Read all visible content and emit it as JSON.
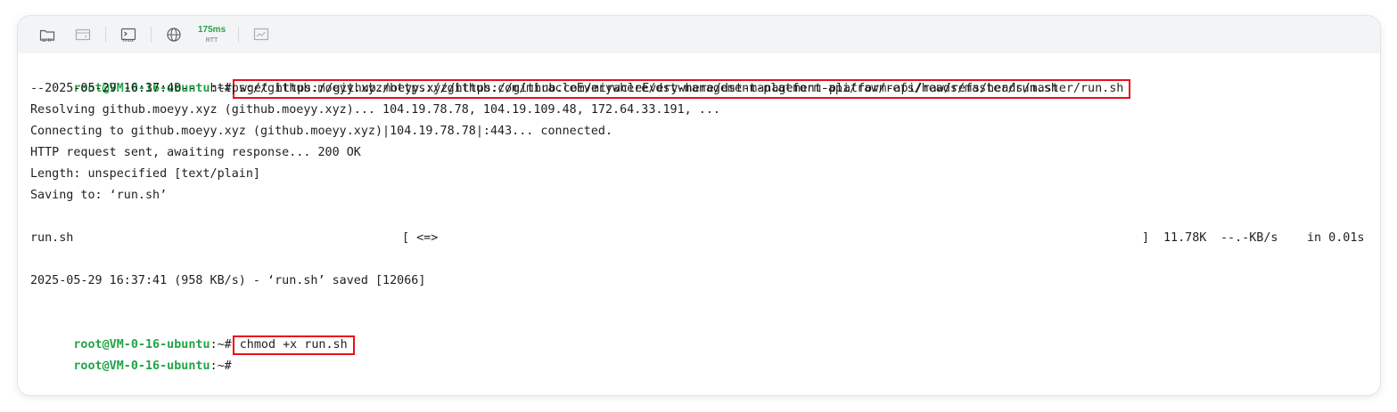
{
  "toolbar": {
    "sftp_label": "SFTP",
    "linux_label": "linux",
    "rtt_value": "175ms",
    "rtt_unit": "RTT"
  },
  "prompt": {
    "user_host": "root@VM-0-16-ubuntu",
    "tail": ":~#"
  },
  "commands": {
    "first": "wget https://github.moeyy.xyz/https://github.com/miracleEverywhere/dst-management-platform-api/raw/refs/heads/master/run.sh",
    "second": "chmod +x run.sh"
  },
  "output": {
    "l1": "--2025-05-29 16:37:40--  https://github.moeyy.xyz/https://github.com/miracleEverywhere/dst-management-platform-api/raw/refs/heads/master/run.sh",
    "l2": "Resolving github.moeyy.xyz (github.moeyy.xyz)... 104.19.78.78, 104.19.109.48, 172.64.33.191, ...",
    "l3": "Connecting to github.moeyy.xyz (github.moeyy.xyz)|104.19.78.78|:443... connected.",
    "l4": "HTTP request sent, awaiting response... 200 OK",
    "l5": "Length: unspecified [text/plain]",
    "l6": "Saving to: ‘run.sh’",
    "progress_file": "run.sh",
    "progress_bar": "[ <=>",
    "progress_end": "]",
    "progress_size": "11.78K",
    "progress_speed": "--.-KB/s",
    "progress_time": "in 0.01s",
    "l8": "2025-05-29 16:37:41 (958 KB/s) - ‘run.sh’ saved [12066]"
  }
}
